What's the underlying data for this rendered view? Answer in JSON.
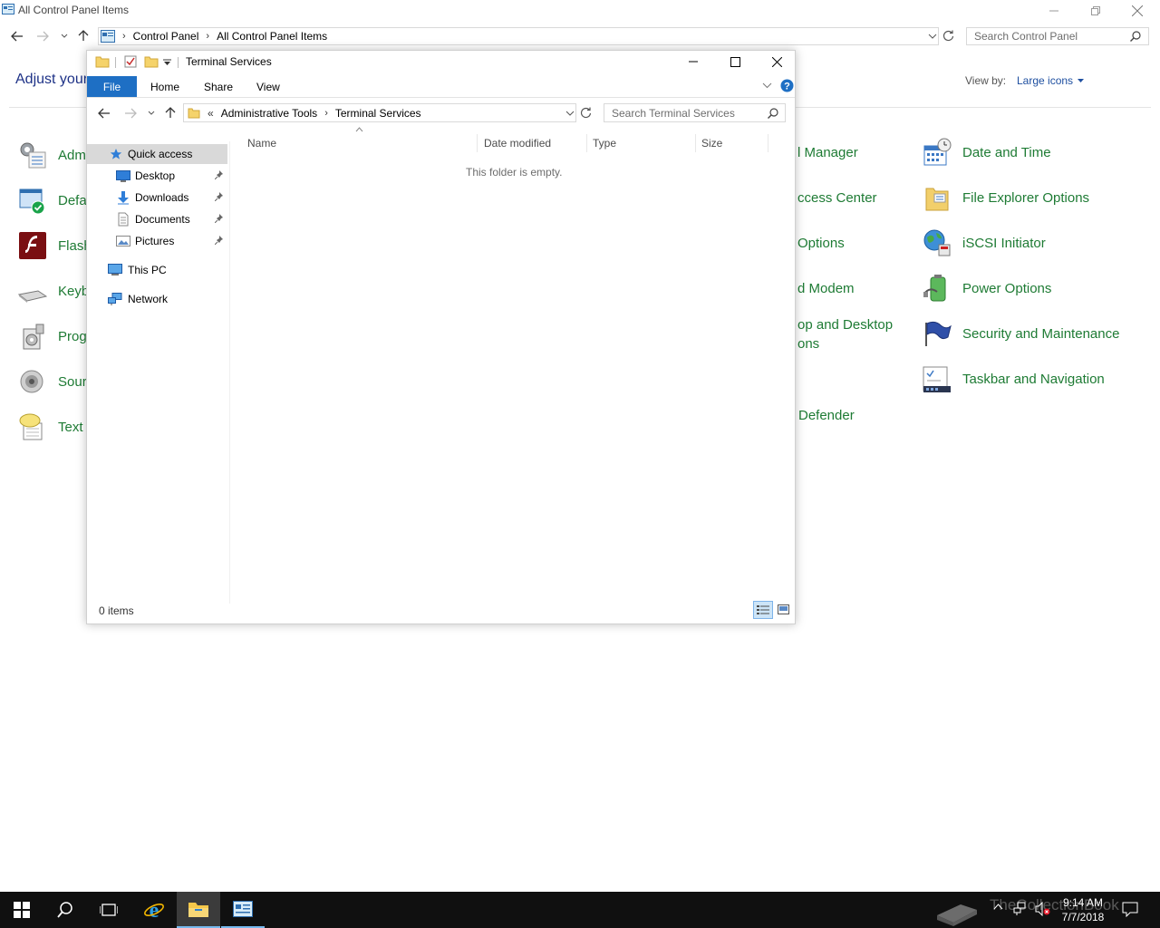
{
  "control_panel": {
    "window_title": "All Control Panel Items",
    "breadcrumb": [
      "Control Panel",
      "All Control Panel Items"
    ],
    "search_placeholder": "Search Control Panel",
    "heading": "Adjust your",
    "view_by_label": "View by:",
    "view_by_value": "Large icons",
    "left_items": [
      "Adm",
      "Defa",
      "Flash",
      "Keyb",
      "Prog",
      "Sour",
      "Text t"
    ],
    "middle_items": [
      "l Manager",
      "ccess Center",
      "Options",
      "d Modem",
      "op and Desktop",
      "ons",
      "Defender"
    ],
    "right_items": [
      "Date and Time",
      "File Explorer Options",
      "iSCSI Initiator",
      "Power Options",
      "Security and Maintenance",
      "Taskbar and Navigation"
    ]
  },
  "explorer": {
    "title": "Terminal Services",
    "ribbon_tabs": [
      "File",
      "Home",
      "Share",
      "View"
    ],
    "breadcrumb": [
      "Administrative Tools",
      "Terminal Services"
    ],
    "breadcrumb_prefix": "«",
    "search_placeholder": "Search Terminal Services",
    "columns": [
      "Name",
      "Date modified",
      "Type",
      "Size"
    ],
    "empty_message": "This folder is empty.",
    "nav": {
      "quick_access": "Quick access",
      "pinned": [
        "Desktop",
        "Downloads",
        "Documents",
        "Pictures"
      ],
      "this_pc": "This PC",
      "network": "Network"
    },
    "status": "0 items"
  },
  "taskbar": {
    "time": "9:14 AM",
    "date": "7/7/2018",
    "watermark": "TheCollectionBook"
  }
}
